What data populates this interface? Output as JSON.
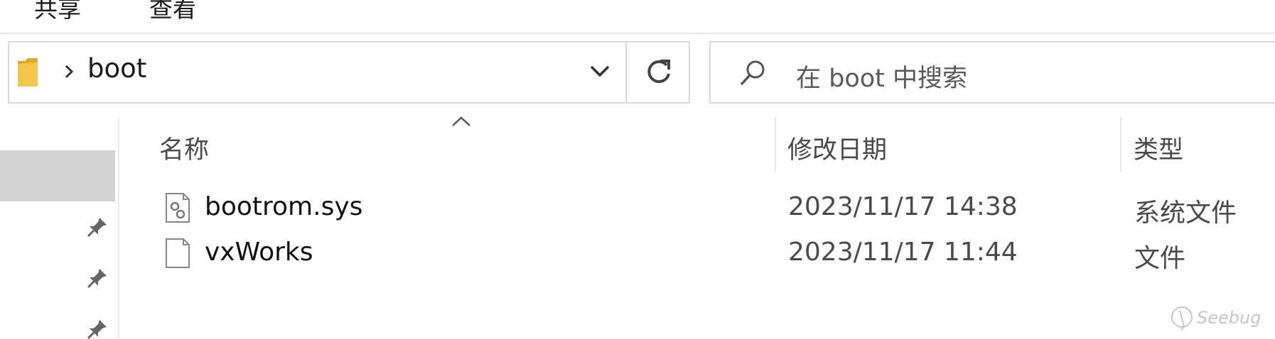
{
  "ribbon": {
    "tabs": [
      {
        "label": "共享"
      },
      {
        "label": "查看"
      }
    ]
  },
  "address_bar": {
    "breadcrumb": [
      "boot"
    ],
    "folder_icon": "folder-icon",
    "dropdown_icon": "chevron-down-icon",
    "refresh_icon": "refresh-icon"
  },
  "search": {
    "placeholder": "在 boot 中搜索",
    "icon": "search-icon"
  },
  "columns": {
    "name": "名称",
    "date": "修改日期",
    "type": "类型",
    "sort_indicator": "sort-ascending-icon"
  },
  "files": [
    {
      "name": "bootrom.sys",
      "date": "2023/11/17 14:38",
      "type": "系统文件",
      "icon": "system-file-icon"
    },
    {
      "name": "vxWorks",
      "date": "2023/11/17 11:44",
      "type": "文件",
      "icon": "blank-file-icon"
    }
  ],
  "nav_pane": {
    "pin_icons": [
      "pin-icon",
      "pin-icon",
      "pin-icon"
    ]
  },
  "watermark": {
    "text": "Seebug"
  },
  "colors": {
    "folder_yellow": "#f2c74c",
    "selection_gray": "#d3d3d3",
    "border_gray": "#d9d9d9"
  }
}
